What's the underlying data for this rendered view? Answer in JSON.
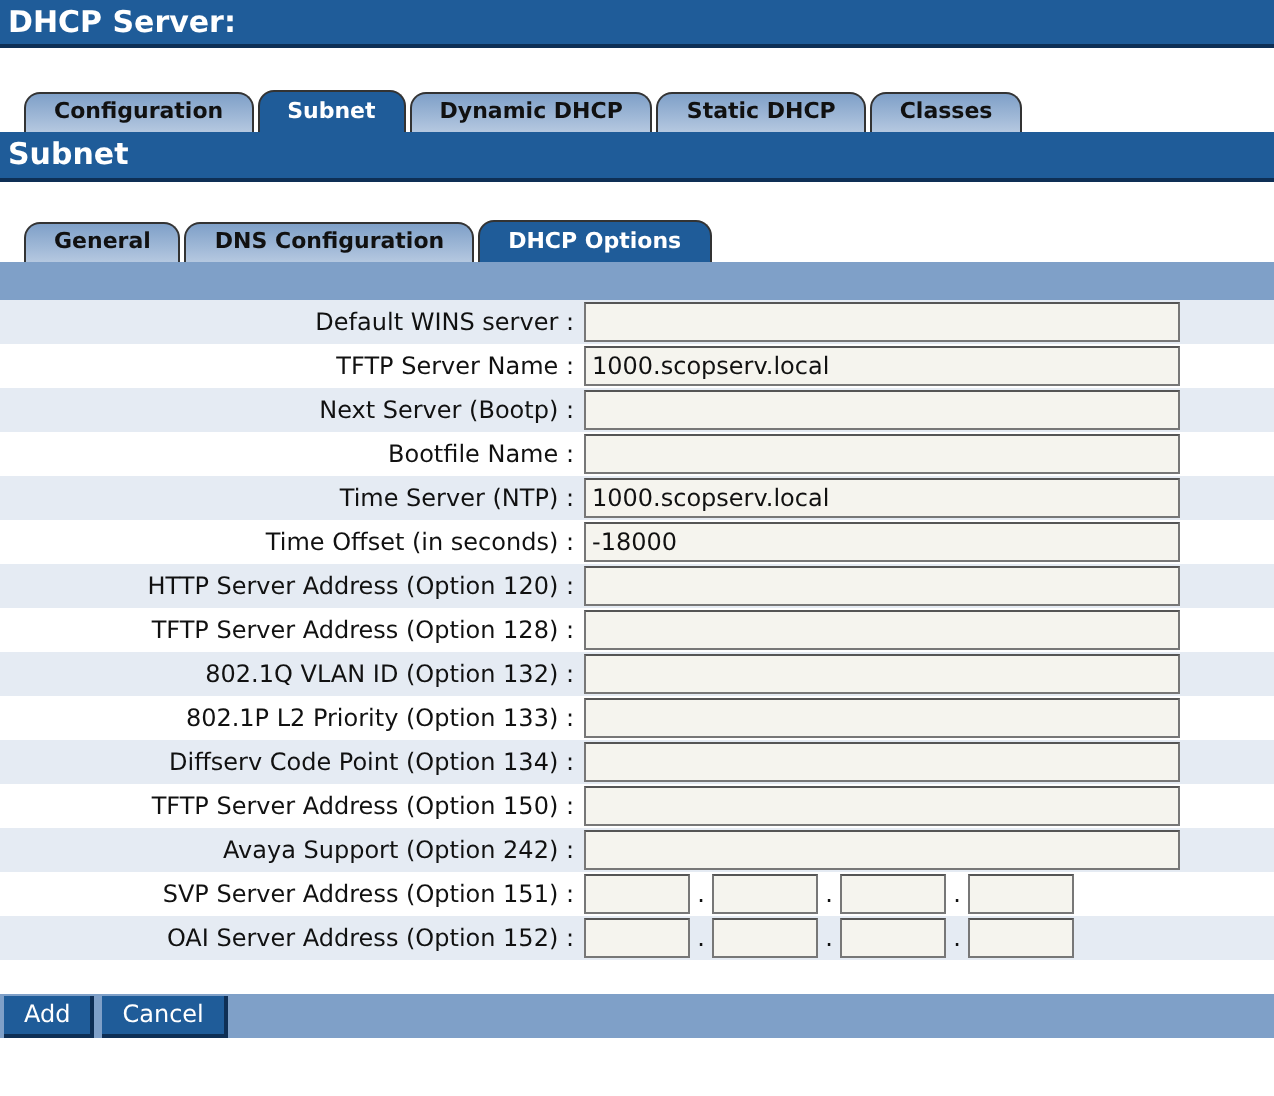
{
  "page_title": "DHCP Server:",
  "tabs": [
    {
      "label": "Configuration",
      "selected": false
    },
    {
      "label": "Subnet",
      "selected": true
    },
    {
      "label": "Dynamic DHCP",
      "selected": false
    },
    {
      "label": "Static DHCP",
      "selected": false
    },
    {
      "label": "Classes",
      "selected": false
    }
  ],
  "section_title": "Subnet",
  "subtabs": [
    {
      "label": "General",
      "selected": false
    },
    {
      "label": "DNS Configuration",
      "selected": false
    },
    {
      "label": "DHCP Options",
      "selected": true
    }
  ],
  "fields": [
    {
      "label": "Default WINS server :",
      "kind": "text"
    },
    {
      "label": "TFTP Server Name :",
      "kind": "text",
      "value": "1000.scopserv.local"
    },
    {
      "label": "Next Server (Bootp) :",
      "kind": "text"
    },
    {
      "label": "Bootfile Name :",
      "kind": "text"
    },
    {
      "label": "Time Server (NTP) :",
      "kind": "text",
      "value": "1000.scopserv.local"
    },
    {
      "label": "Time Offset (in seconds) :",
      "kind": "text",
      "value": "-18000"
    },
    {
      "label": "HTTP Server Address (Option 120) :",
      "kind": "text"
    },
    {
      "label": "TFTP Server Address (Option 128) :",
      "kind": "text"
    },
    {
      "label": "802.1Q VLAN ID (Option 132) :",
      "kind": "text"
    },
    {
      "label": "802.1P L2 Priority (Option 133) :",
      "kind": "text"
    },
    {
      "label": "Diffserv Code Point (Option 134) :",
      "kind": "text"
    },
    {
      "label": "TFTP Server Address (Option 150) :",
      "kind": "text"
    },
    {
      "label": "Avaya Support (Option 242) :",
      "kind": "text"
    },
    {
      "label": "SVP Server Address (Option 151) :",
      "kind": "ip",
      "separators": [
        ".",
        ".",
        "."
      ]
    },
    {
      "label": "OAI Server Address (Option 152) :",
      "kind": "ip",
      "separators": [
        ".",
        ".",
        "."
      ]
    }
  ],
  "buttons": [
    "Add",
    "Cancel"
  ]
}
